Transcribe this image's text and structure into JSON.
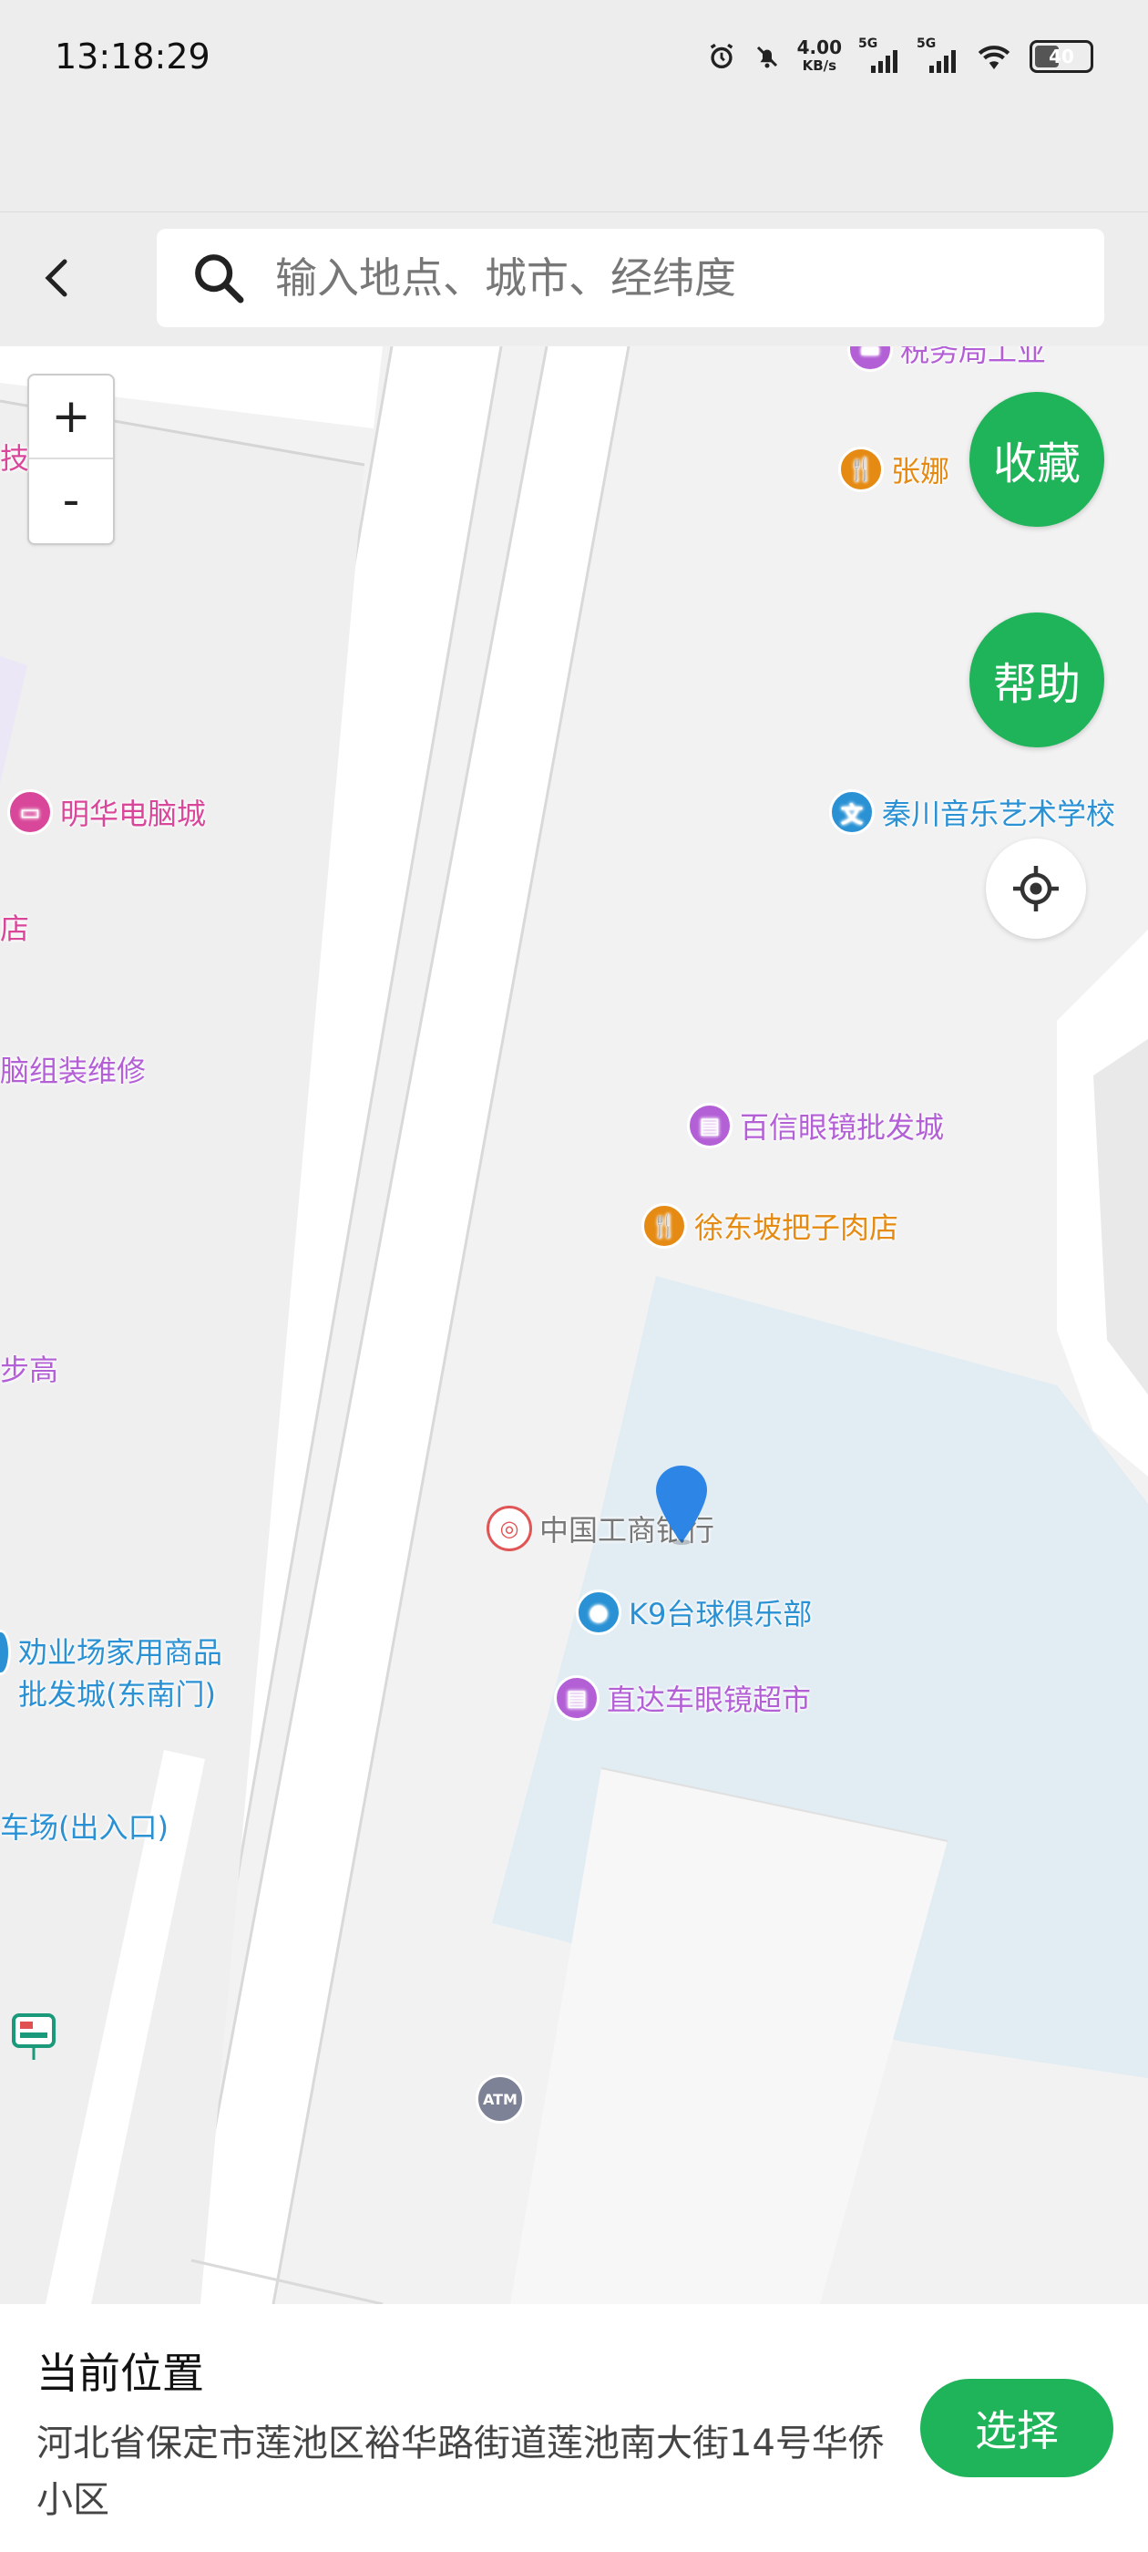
{
  "status_bar": {
    "time": "13:18:29",
    "net_speed_value": "4.00",
    "net_speed_unit": "KB/s",
    "signal_1_label": "5G",
    "signal_2_label": "5G",
    "battery_level": "40",
    "icons": [
      "alarm-icon",
      "mute-icon",
      "signal-icon",
      "wifi-icon",
      "battery-icon"
    ]
  },
  "search": {
    "placeholder": "输入地点、城市、经纬度",
    "value": ""
  },
  "map": {
    "zoom_in_label": "+",
    "zoom_out_label": "-",
    "favorite_label": "收藏",
    "help_label": "帮助",
    "pois": [
      {
        "label": "税务局工业",
        "color": "#b35fd6",
        "icon": "building-icon"
      },
      {
        "label": "技",
        "color": "#d9479a",
        "icon": "none"
      },
      {
        "label": "张娜",
        "color": "#e58a12",
        "icon": "restaurant-icon"
      },
      {
        "label": "明华电脑城",
        "color": "#d9479a",
        "icon": "computer-icon"
      },
      {
        "label": "秦川音乐艺术学校",
        "color": "#2a92d4",
        "icon": "school-icon"
      },
      {
        "label": "店",
        "color": "#d9479a",
        "icon": "none"
      },
      {
        "label": "脑组装维修",
        "color": "#b35fd6",
        "icon": "none"
      },
      {
        "label": "百信眼镜批发城",
        "color": "#b35fd6",
        "icon": "shop-icon"
      },
      {
        "label": "徐东坡把子肉店",
        "color": "#e58a12",
        "icon": "restaurant-icon"
      },
      {
        "label": "步高",
        "color": "#b35fd6",
        "icon": "none"
      },
      {
        "label": "中国工商银行",
        "color": "#777777",
        "icon": "bank-icon"
      },
      {
        "label": "K9台球俱乐部",
        "color": "#2a92d4",
        "icon": "billiards-icon"
      },
      {
        "label": "劝业场家用商品",
        "label2": "批发城(东南门)",
        "color": "#2a92d4",
        "icon": "none"
      },
      {
        "label": "直达车眼镜超市",
        "color": "#b35fd6",
        "icon": "shop-icon"
      },
      {
        "label": "车场(出入口)",
        "color": "#2a92d4",
        "icon": "none"
      }
    ],
    "atm_label": "ATM"
  },
  "bottom": {
    "title": "当前位置",
    "address": "河北省保定市莲池区裕华路街道莲池南大街14号华侨小区",
    "select_label": "选择"
  }
}
